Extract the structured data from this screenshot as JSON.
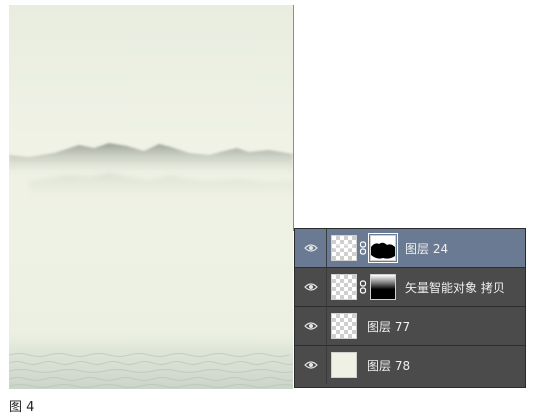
{
  "canvas": {
    "colors": {
      "paper": "#eef1e4",
      "mist": "#d7dccd",
      "mountain": "#9aa095",
      "water": "#c9d2c7"
    }
  },
  "layers_panel": {
    "layers": [
      {
        "name": "图层 24",
        "selected": true,
        "visible": true,
        "has_mask": true,
        "thumbnail": "transparent-checker"
      },
      {
        "name": "矢量智能对象 拷贝",
        "selected": false,
        "visible": true,
        "has_mask": true,
        "thumbnail": "transparent-checker"
      },
      {
        "name": "图层 77",
        "selected": false,
        "visible": true,
        "has_mask": false,
        "thumbnail": "transparent-checker"
      },
      {
        "name": "图层 78",
        "selected": false,
        "visible": true,
        "has_mask": false,
        "thumbnail": "paper-color"
      }
    ],
    "colors": {
      "panel_bg": "#4b4b4b",
      "selected_bg": "#6b7a93",
      "text": "#f0f0f0"
    }
  },
  "caption": "图 4"
}
